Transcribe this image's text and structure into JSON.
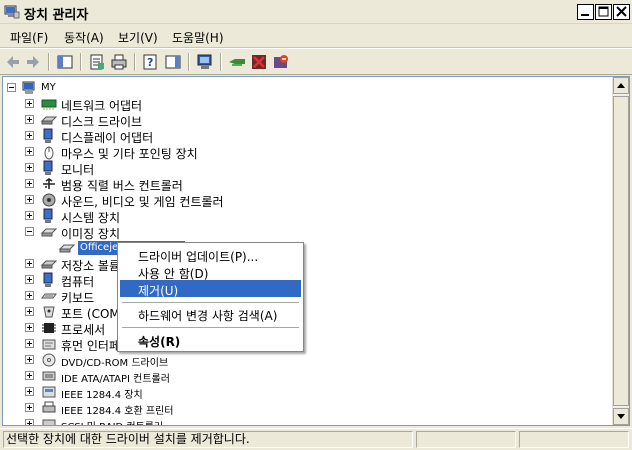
{
  "window": {
    "title": "장치 관리자"
  },
  "menu": [
    {
      "label": "파일(F)"
    },
    {
      "label": "동작(A)"
    },
    {
      "label": "보기(V)"
    },
    {
      "label": "도움말(H)"
    }
  ],
  "tree": {
    "root": "MY",
    "items": [
      {
        "label": "네트워크 어댑터",
        "icon": "network-adapter-icon"
      },
      {
        "label": "디스크 드라이브",
        "icon": "disk-drive-icon"
      },
      {
        "label": "디스플레이 어댑터",
        "icon": "display-adapter-icon"
      },
      {
        "label": "마우스 및 기타 포인팅 장치",
        "icon": "mouse-icon"
      },
      {
        "label": "모니터",
        "icon": "monitor-icon"
      },
      {
        "label": "범용 직렬 버스 컨트롤러",
        "icon": "usb-icon"
      },
      {
        "label": "사운드, 비디오 및 게임 컨트롤러",
        "icon": "sound-icon"
      },
      {
        "label": "시스템 장치",
        "icon": "system-device-icon"
      },
      {
        "label": "이미징 장치",
        "icon": "imaging-device-icon",
        "expanded": true
      },
      {
        "label": "Officejet",
        "icon": "scanner-icon",
        "child": true,
        "selected": true
      },
      {
        "label": "저장소 볼륨",
        "icon": "storage-volume-icon"
      },
      {
        "label": "컴퓨터",
        "icon": "computer-icon"
      },
      {
        "label": "키보드",
        "icon": "keyboard-icon"
      },
      {
        "label": "포트 (COM",
        "icon": "port-icon"
      },
      {
        "label": "프로세서",
        "icon": "processor-icon"
      },
      {
        "label": "휴먼 인터페",
        "icon": "hid-icon"
      },
      {
        "label": "DVD/CD-ROM 드라이브",
        "icon": "cdrom-icon"
      },
      {
        "label": "IDE ATA/ATAPI 컨트롤러",
        "icon": "ide-controller-icon"
      },
      {
        "label": "IEEE 1284.4 장치",
        "icon": "ieee1284-icon"
      },
      {
        "label": "IEEE 1284.4 호환 프린터",
        "icon": "printer-icon"
      },
      {
        "label": "SCSI 및 RAID 컨트롤러",
        "icon": "scsi-icon"
      }
    ]
  },
  "context_menu": {
    "items": [
      {
        "label": "드라이버 업데이트(P)..."
      },
      {
        "label": "사용 안 함(D)"
      },
      {
        "label": "제거(U)",
        "highlighted": true
      },
      {
        "separator": true
      },
      {
        "label": "하드웨어 변경 사항 검색(A)"
      },
      {
        "separator": true
      },
      {
        "label": "속성(R)",
        "bold": true
      }
    ]
  },
  "status": {
    "text": "선택한 장치에 대한 드라이버 설치를 제거합니다."
  },
  "colors": {
    "selection": "#316ac5",
    "face": "#ece9d8"
  }
}
